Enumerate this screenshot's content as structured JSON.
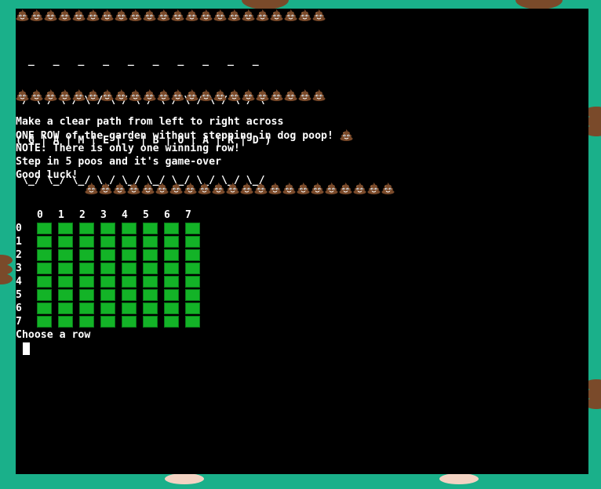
{
  "emoji": {
    "poo": "poo-icon",
    "poo_colors": {
      "body": "#7a4a2a",
      "highlight": "#a8744a"
    }
  },
  "colors": {
    "page_bg": "#1ab08a",
    "terminal_bg": "#000000",
    "cell_fill": "#13b327",
    "text": "#ffffff"
  },
  "banner": {
    "line1": "  _   _   _   _   _   _   _   _   _   _",
    "line2": " / \\ / \\ / \\ / \\ / \\ / \\ / \\ / \\ / \\ / \\",
    "line3": "( G | A | M | E | - | B | O | A | R | D )",
    "line4": " \\_/ \\_/ \\_/ \\_/ \\_/ \\_/ \\_/ \\_/ \\_/ \\_/"
  },
  "instructions": {
    "line1": "Make a clear path from left to right across",
    "line2": "ONE ROW of the garden without stepping in dog poop! ",
    "line3": "NOTE: There is only one winning row!",
    "line4": "Step in 5 poos and it's game-over",
    "line5": "Good luck!"
  },
  "board": {
    "columns": [
      "0",
      "1",
      "2",
      "3",
      "4",
      "5",
      "6",
      "7"
    ],
    "rows": [
      "0",
      "1",
      "2",
      "3",
      "4",
      "5",
      "6",
      "7"
    ]
  },
  "prompt": "Choose a row"
}
